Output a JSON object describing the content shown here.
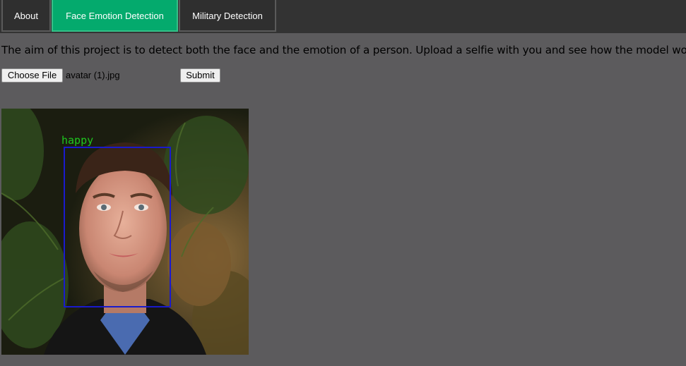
{
  "tabs": [
    {
      "label": "About",
      "active": false
    },
    {
      "label": "Face Emotion Detection",
      "active": true
    },
    {
      "label": "Military Detection",
      "active": false
    }
  ],
  "description": "The aim of this project is to detect both the face and the emotion of a person. Upload a selfie with you and see how the model works:",
  "upload": {
    "choose_file_label": "Choose File",
    "file_name": "avatar (1).jpg",
    "submit_label": "Submit"
  },
  "result": {
    "emotion_label": "happy",
    "box_color": "#1a1acc",
    "label_color": "#1ec81e"
  },
  "colors": {
    "page_background": "#5c5b5d",
    "tabbar_background": "#333333",
    "active_tab": "#04aa6d"
  }
}
